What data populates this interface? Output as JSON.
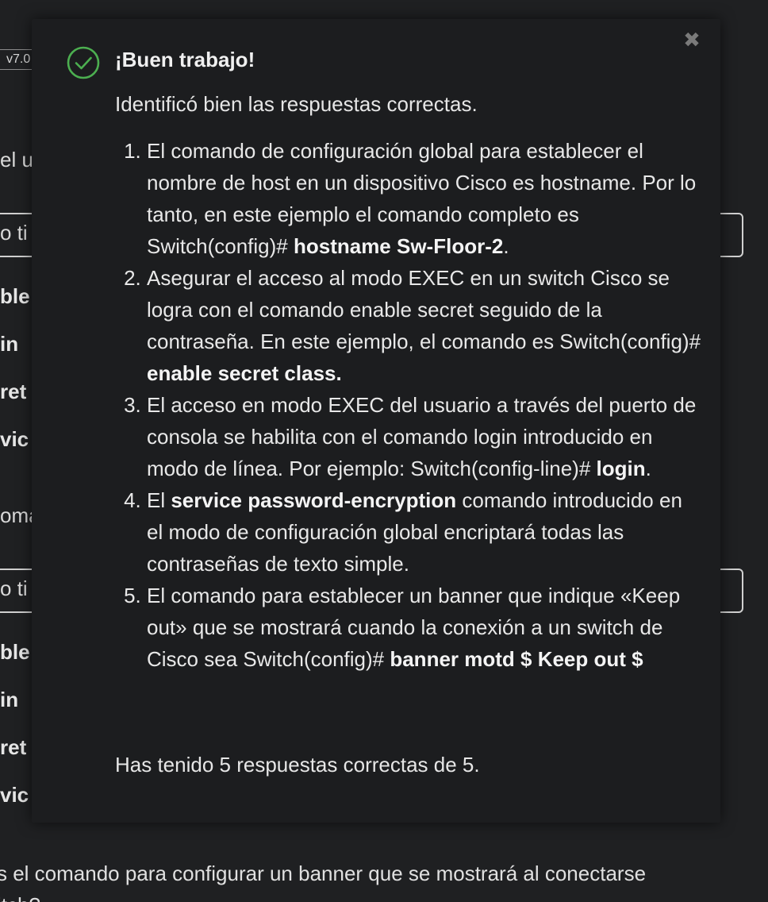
{
  "background": {
    "version_badge": "v7.0",
    "fragments": {
      "line1": "el u",
      "input1": "o ti",
      "bold1": "ble",
      "bold2": "in",
      "bold3": "ret",
      "bold4": "vic",
      "line2": "oma",
      "input2": "o ti",
      "bold5": "ble",
      "bold6": "in",
      "bold7": "ret",
      "bold8": "vic"
    },
    "question_text": "s el comando para configurar un banner que se mostrará al conectarse",
    "question_text_line2": "itch?"
  },
  "modal": {
    "close_icon": "✖",
    "title": "¡Buen trabajo!",
    "intro": "Identificó bien las respuestas correctas.",
    "answers": [
      {
        "pre": "El comando de configuración global para establecer el nombre de host en un dispositivo Cisco es hostname. Por lo tanto, en este ejemplo el comando completo es Switch(config)# ",
        "bold": "hostname Sw-Floor-2",
        "post": "."
      },
      {
        "pre": "Asegurar el acceso al modo EXEC en un switch Cisco se logra con el comando enable secret seguido de la contraseña. En este ejemplo, el comando es Switch(config)# ",
        "bold": "enable secret class.",
        "post": ""
      },
      {
        "pre": "El acceso en modo EXEC del usuario a través del puerto de consola se habilita con el comando login introducido en modo de línea. Por ejemplo: Switch(config-line)# ",
        "bold": "login",
        "post": "."
      },
      {
        "pre": "El ",
        "bold": "service password-encryption",
        "post": " comando introducido en el modo de configuración global encriptará todas las contraseñas de texto simple."
      },
      {
        "pre": "El comando para establecer un banner que indique «Keep out» que se mostrará cuando la conexión a un switch de Cisco sea Switch(config)# ",
        "bold": "banner motd $ Keep out $",
        "post": ""
      }
    ],
    "score": "Has tenido 5 respuestas correctas de 5.",
    "accent_color": "#4caf50"
  }
}
